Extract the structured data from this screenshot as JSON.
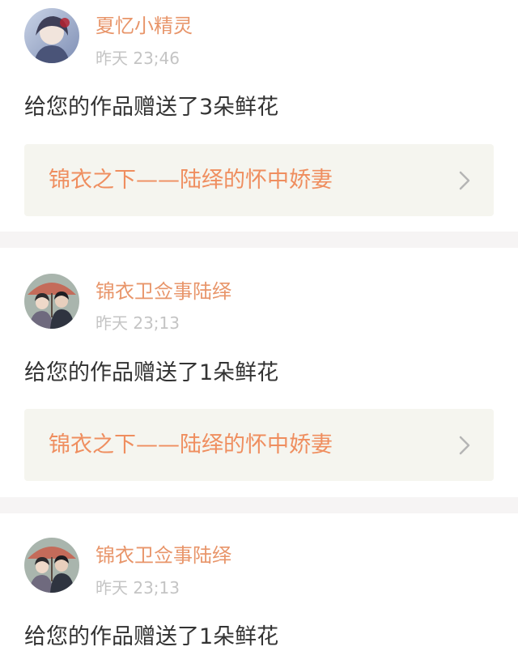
{
  "feed": {
    "items": [
      {
        "username": "夏忆小精灵",
        "time": "昨天 23;46",
        "message": "给您的作品赠送了3朵鲜花",
        "work_title": "锦衣之下——陆绎的怀中娇妻",
        "avatar": "avatar-girl-blue"
      },
      {
        "username": "锦衣卫佥事陆绎",
        "time": "昨天 23;13",
        "message": "给您的作品赠送了1朵鲜花",
        "work_title": "锦衣之下——陆绎的怀中娇妻",
        "avatar": "avatar-couple-umbrella"
      },
      {
        "username": "锦衣卫佥事陆绎",
        "time": "昨天 23;13",
        "message": "给您的作品赠送了1朵鲜花",
        "avatar": "avatar-couple-umbrella"
      }
    ]
  },
  "colors": {
    "username": "#e8956a",
    "timestamp": "#c4c4c4",
    "body_text": "#333333",
    "link_text": "#ef8e5f",
    "link_background": "#f5f5ef",
    "divider": "#f6f4f4"
  },
  "icons": {
    "link_arrow": "chevron-right-icon"
  }
}
